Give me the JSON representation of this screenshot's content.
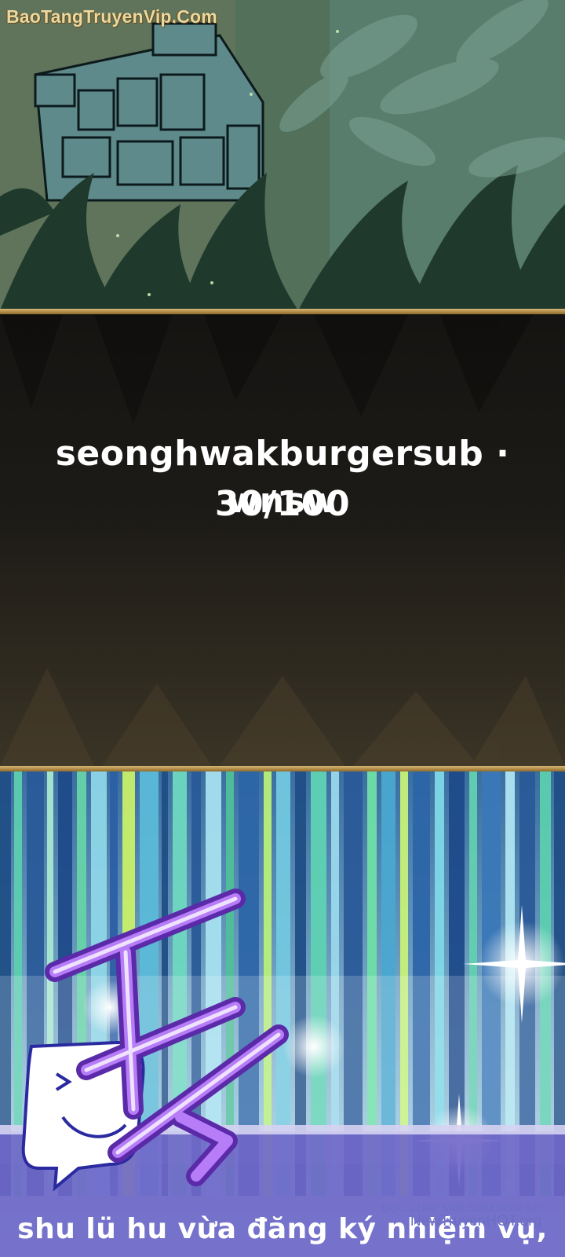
{
  "watermark_top": "BaoTangTruyenVip.Com",
  "credit": {
    "line1": "seonghwakburgersub · wnsw",
    "line2": "30/100"
  },
  "caption": "shu lü hu vừa đăng ký nhiệm vụ,",
  "watermark_bottom": {
    "line1": "ĐỌC CHAP MỚI SỚM HƠN TẠI",
    "line2": "NewTruyenHOT.org"
  },
  "sfx_icon": "ding-sfx-icon",
  "colors": {
    "gold_border": "#c9a45c",
    "jungle_green": "#4f6a52",
    "speed_teal": "#6aaec7",
    "sfx_purple": "#8a3ef0"
  }
}
